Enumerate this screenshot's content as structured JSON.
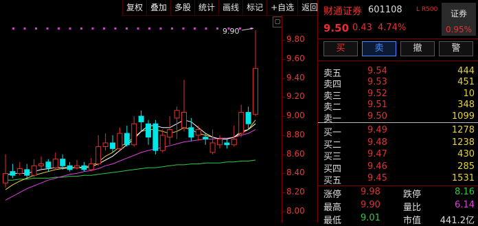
{
  "toolbar": {
    "buttons": [
      "复权",
      "叠加",
      "多股",
      "统计",
      "画线",
      "标记",
      "+自选",
      "返回"
    ]
  },
  "chart": {
    "y_axis": [
      "9.80",
      "9.60",
      "9.40",
      "9.20",
      "9.00",
      "8.80",
      "8.60",
      "8.40",
      "8.20",
      "8.00"
    ],
    "high_marker": "9.90",
    "candles": [
      {
        "o": 8.3,
        "c": 8.4,
        "h": 8.6,
        "l": 8.25
      },
      {
        "o": 8.42,
        "c": 8.38,
        "h": 8.5,
        "l": 8.35
      },
      {
        "o": 8.4,
        "c": 8.45,
        "h": 8.52,
        "l": 8.38
      },
      {
        "o": 8.44,
        "c": 8.38,
        "h": 8.5,
        "l": 8.34
      },
      {
        "o": 8.38,
        "c": 8.48,
        "h": 8.55,
        "l": 8.36
      },
      {
        "o": 8.48,
        "c": 8.5,
        "h": 8.58,
        "l": 8.44
      },
      {
        "o": 8.52,
        "c": 8.46,
        "h": 8.55,
        "l": 8.42
      },
      {
        "o": 8.46,
        "c": 8.55,
        "h": 8.62,
        "l": 8.44
      },
      {
        "o": 8.55,
        "c": 8.48,
        "h": 8.6,
        "l": 8.44
      },
      {
        "o": 8.48,
        "c": 8.44,
        "h": 8.52,
        "l": 8.42
      },
      {
        "o": 8.46,
        "c": 8.48,
        "h": 8.54,
        "l": 8.44
      },
      {
        "o": 8.48,
        "c": 8.44,
        "h": 8.52,
        "l": 8.42
      },
      {
        "o": 8.44,
        "c": 8.5,
        "h": 8.56,
        "l": 8.42
      },
      {
        "o": 8.5,
        "c": 8.68,
        "h": 8.8,
        "l": 8.48
      },
      {
        "o": 8.68,
        "c": 8.72,
        "h": 8.82,
        "l": 8.64
      },
      {
        "o": 8.72,
        "c": 8.66,
        "h": 8.8,
        "l": 8.62
      },
      {
        "o": 8.66,
        "c": 8.82,
        "h": 8.88,
        "l": 8.64
      },
      {
        "o": 8.82,
        "c": 8.7,
        "h": 8.9,
        "l": 8.68
      },
      {
        "o": 8.7,
        "c": 8.92,
        "h": 9.0,
        "l": 8.68
      },
      {
        "o": 9.0,
        "c": 8.94,
        "h": 9.06,
        "l": 8.84
      },
      {
        "o": 8.92,
        "c": 8.78,
        "h": 8.96,
        "l": 8.7
      },
      {
        "o": 8.92,
        "c": 8.64,
        "h": 8.96,
        "l": 8.6
      },
      {
        "o": 8.64,
        "c": 8.8,
        "h": 8.86,
        "l": 8.62
      },
      {
        "o": 8.78,
        "c": 8.86,
        "h": 9.0,
        "l": 8.7
      },
      {
        "o": 8.98,
        "c": 9.06,
        "h": 9.1,
        "l": 8.76
      },
      {
        "o": 8.88,
        "c": 9.04,
        "h": 9.38,
        "l": 8.84
      },
      {
        "o": 8.88,
        "c": 8.78,
        "h": 8.98,
        "l": 8.74
      },
      {
        "o": 8.8,
        "c": 8.86,
        "h": 8.9,
        "l": 8.74
      },
      {
        "o": 8.78,
        "c": 8.76,
        "h": 8.82,
        "l": 8.7
      },
      {
        "o": 8.62,
        "c": 8.72,
        "h": 8.86,
        "l": 8.6
      },
      {
        "o": 8.7,
        "c": 8.76,
        "h": 8.8,
        "l": 8.66
      },
      {
        "o": 8.72,
        "c": 8.7,
        "h": 8.76,
        "l": 8.66
      },
      {
        "o": 8.7,
        "c": 8.76,
        "h": 8.9,
        "l": 8.68
      },
      {
        "o": 8.82,
        "c": 9.04,
        "h": 9.12,
        "l": 8.78
      },
      {
        "o": 9.04,
        "c": 8.92,
        "h": 9.1,
        "l": 8.86
      },
      {
        "o": 9.02,
        "c": 9.5,
        "h": 9.9,
        "l": 9.0
      }
    ],
    "ma_yellow": [
      8.23,
      8.28,
      8.32,
      8.35,
      8.38,
      8.4,
      8.42,
      8.44,
      8.45,
      8.46,
      8.46,
      8.47,
      8.48,
      8.52,
      8.58,
      8.62,
      8.68,
      8.72,
      8.78,
      8.84,
      8.86,
      8.86,
      8.84,
      8.82,
      8.84,
      8.88,
      8.86,
      8.82,
      8.8,
      8.78,
      8.76,
      8.76,
      8.78,
      8.82,
      8.86,
      8.96
    ],
    "ma_white": [
      8.38,
      8.4,
      8.4,
      8.4,
      8.42,
      8.44,
      8.45,
      8.46,
      8.46,
      8.46,
      8.46,
      8.46,
      8.47,
      8.5,
      8.54,
      8.58,
      8.64,
      8.7,
      8.76,
      8.84,
      8.9,
      8.9,
      8.88,
      8.88,
      8.92,
      8.96,
      8.94,
      8.88,
      8.82,
      8.78,
      8.76,
      8.76,
      8.78,
      8.84,
      8.86,
      8.92
    ],
    "ma_magenta": [
      8.12,
      8.16,
      8.2,
      8.24,
      8.27,
      8.3,
      8.33,
      8.35,
      8.37,
      8.39,
      8.4,
      8.42,
      8.43,
      8.45,
      8.48,
      8.5,
      8.53,
      8.56,
      8.59,
      8.62,
      8.64,
      8.66,
      8.67,
      8.69,
      8.71,
      8.73,
      8.74,
      8.75,
      8.76,
      8.76,
      8.77,
      8.77,
      8.78,
      8.8,
      8.82,
      8.86
    ],
    "ma_green": [
      8.33,
      8.33,
      8.34,
      8.34,
      8.35,
      8.35,
      8.35,
      8.36,
      8.36,
      8.37,
      8.37,
      8.38,
      8.38,
      8.39,
      8.4,
      8.41,
      8.42,
      8.43,
      8.44,
      8.45,
      8.46,
      8.46,
      8.47,
      8.48,
      8.49,
      8.49,
      8.5,
      8.5,
      8.51,
      8.51,
      8.51,
      8.52,
      8.52,
      8.53,
      8.53,
      8.54
    ]
  },
  "stock": {
    "name": "财通证券",
    "code": "601108",
    "flags": "L R500",
    "sector_label": "证券",
    "sector_pct": "0.95%",
    "price": "9.50",
    "change": "0.43",
    "change_pct": "4.74%"
  },
  "trade": {
    "buy": "买",
    "sell": "卖",
    "cancel": "撤",
    "alert": "警"
  },
  "asks": [
    {
      "label": "卖五",
      "price": "9.54",
      "vol": "444"
    },
    {
      "label": "卖四",
      "price": "9.53",
      "vol": "451"
    },
    {
      "label": "卖三",
      "price": "9.52",
      "vol": "10"
    },
    {
      "label": "卖二",
      "price": "9.51",
      "vol": "348"
    },
    {
      "label": "卖一",
      "price": "9.50",
      "vol": "1099"
    }
  ],
  "bids": [
    {
      "label": "买一",
      "price": "9.49",
      "vol": "1278"
    },
    {
      "label": "买二",
      "price": "9.48",
      "vol": "1238"
    },
    {
      "label": "买三",
      "price": "9.47",
      "vol": "430"
    },
    {
      "label": "买四",
      "price": "9.46",
      "vol": "285"
    },
    {
      "label": "买五",
      "price": "9.45",
      "vol": "1531"
    }
  ],
  "stats": [
    {
      "l1": "涨停",
      "v1": "9.98",
      "c1": "#e63030",
      "l2": "跌停",
      "v2": "8.16",
      "c2": "#2ecc40"
    },
    {
      "l1": "最高",
      "v1": "9.90",
      "c1": "#e63030",
      "l2": "量比",
      "v2": "6.14",
      "c2": "#e040e0"
    },
    {
      "l1": "最低",
      "v1": "9.01",
      "c1": "#2ecc40",
      "l2": "市值",
      "v2": "441.2亿",
      "c2": "#ddd"
    }
  ],
  "colors": {
    "up": "#e63030",
    "down": "#00e5e5",
    "ma_yellow": "#e6d23a",
    "ma_white": "#ffffff",
    "ma_magenta": "#e040e0",
    "ma_green": "#2ecc40"
  }
}
